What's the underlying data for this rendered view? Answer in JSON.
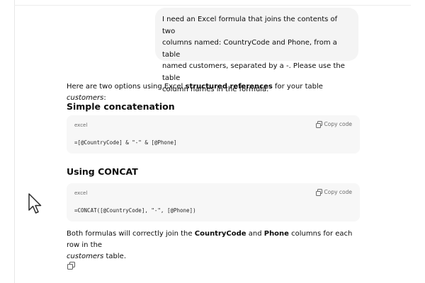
{
  "user_message": {
    "line1": "I need an Excel formula that joins the contents of two",
    "line2": "columns named: CountryCode and Phone, from a table",
    "line3": "named customers, separated by a -. Please use the table",
    "line4": "column names in the formula."
  },
  "response": {
    "intro": {
      "part1": "Here are two options using Excel ",
      "part2_bold": "structured references",
      "part3": " for your table ",
      "part4_italic": "customers",
      "part5": ":"
    },
    "sections": [
      {
        "heading": "Simple concatenation",
        "language": "excel",
        "copy_label": "Copy code",
        "code": "=[@CountryCode] & \"-\" & [@Phone]"
      },
      {
        "heading": "Using CONCAT",
        "language": "excel",
        "copy_label": "Copy code",
        "code": "=CONCAT([@CountryCode], \"-\", [@Phone])"
      }
    ],
    "outro": {
      "part1": "Both formulas will correctly join the ",
      "part2_bold": "CountryCode",
      "part3": " and ",
      "part4_bold": "Phone",
      "part5": " columns for each row in the",
      "part6_italic": "customers",
      "part7": " table."
    }
  },
  "icons": {
    "copy": "copy-icon",
    "cursor": "mouse-pointer-icon"
  }
}
